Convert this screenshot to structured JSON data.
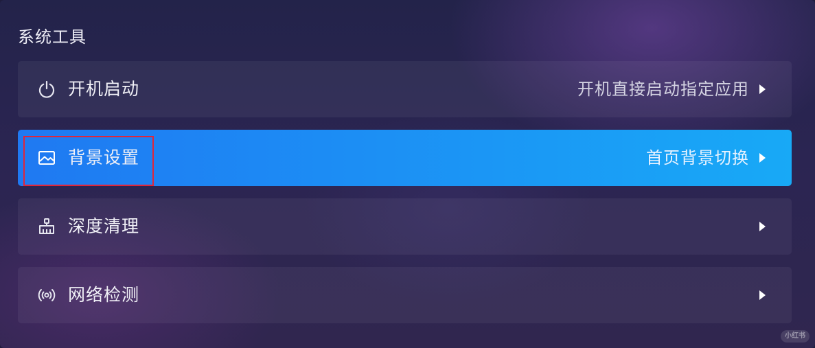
{
  "section": {
    "title": "系统工具"
  },
  "rows": [
    {
      "label": "开机启动",
      "detail": "开机直接启动指定应用",
      "icon": "power-icon",
      "selected": false
    },
    {
      "label": "背景设置",
      "detail": "首页背景切换",
      "icon": "image-icon",
      "selected": true
    },
    {
      "label": "深度清理",
      "detail": "",
      "icon": "broom-icon",
      "selected": false
    },
    {
      "label": "网络检测",
      "detail": "",
      "icon": "signal-icon",
      "selected": false
    }
  ],
  "watermark": {
    "text": "小红书"
  },
  "colors": {
    "selected_start": "#1f79f2",
    "selected_end": "#18a9f6",
    "highlight_border": "#e0263a",
    "text": "#f1f1f7"
  }
}
